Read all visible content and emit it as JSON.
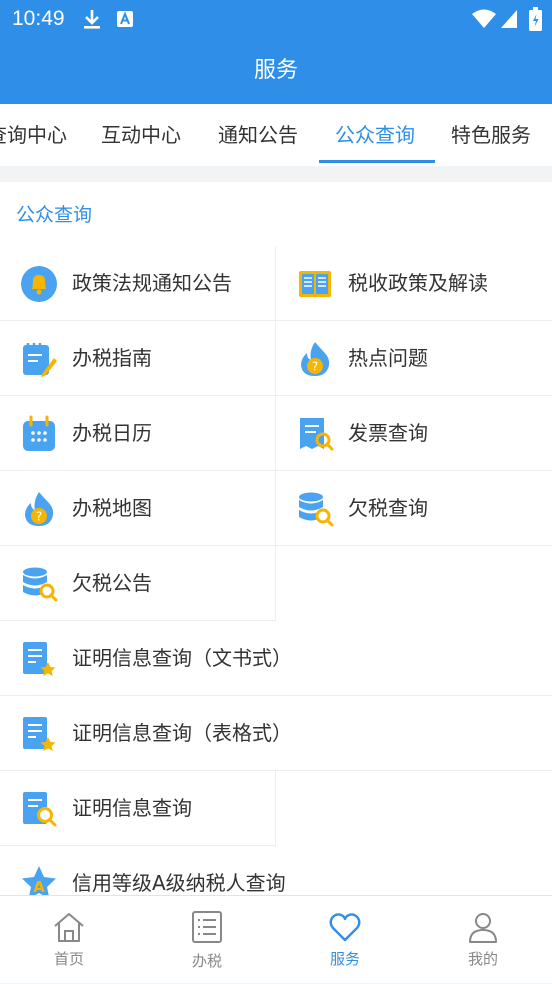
{
  "status": {
    "time": "10:49"
  },
  "header": {
    "title": "服务"
  },
  "tabs": [
    {
      "label": "查询中心"
    },
    {
      "label": "互动中心"
    },
    {
      "label": "通知公告"
    },
    {
      "label": "公众查询",
      "active": true
    },
    {
      "label": "特色服务"
    }
  ],
  "section": {
    "title": "公众查询"
  },
  "items": [
    {
      "label": "政策法规通知公告",
      "icon": "bell-icon"
    },
    {
      "label": "税收政策及解读",
      "icon": "book-icon"
    },
    {
      "label": "办税指南",
      "icon": "notepad-pen-icon"
    },
    {
      "label": "热点问题",
      "icon": "flame-question-icon"
    },
    {
      "label": "办税日历",
      "icon": "calendar-icon"
    },
    {
      "label": "发票查询",
      "icon": "invoice-search-icon"
    },
    {
      "label": "办税地图",
      "icon": "flame-question-icon"
    },
    {
      "label": "欠税查询",
      "icon": "database-search-icon"
    },
    {
      "label": "欠税公告",
      "icon": "database-search-icon"
    },
    {
      "label": "证明信息查询（文书式）",
      "icon": "document-star-icon"
    },
    {
      "label": "证明信息查询（表格式）",
      "icon": "document-star-icon"
    },
    {
      "label": "证明信息查询",
      "icon": "document-search-icon"
    },
    {
      "label": "信用等级A级纳税人查询",
      "icon": "star-a-icon"
    }
  ],
  "bottom_nav": [
    {
      "label": "首页",
      "icon": "home-icon"
    },
    {
      "label": "办税",
      "icon": "list-icon"
    },
    {
      "label": "服务",
      "icon": "heart-icon",
      "active": true
    },
    {
      "label": "我的",
      "icon": "user-icon"
    }
  ],
  "colors": {
    "primary": "#2f8fe8",
    "icon_blue": "#4aa3f0",
    "icon_yellow": "#f6b500"
  }
}
